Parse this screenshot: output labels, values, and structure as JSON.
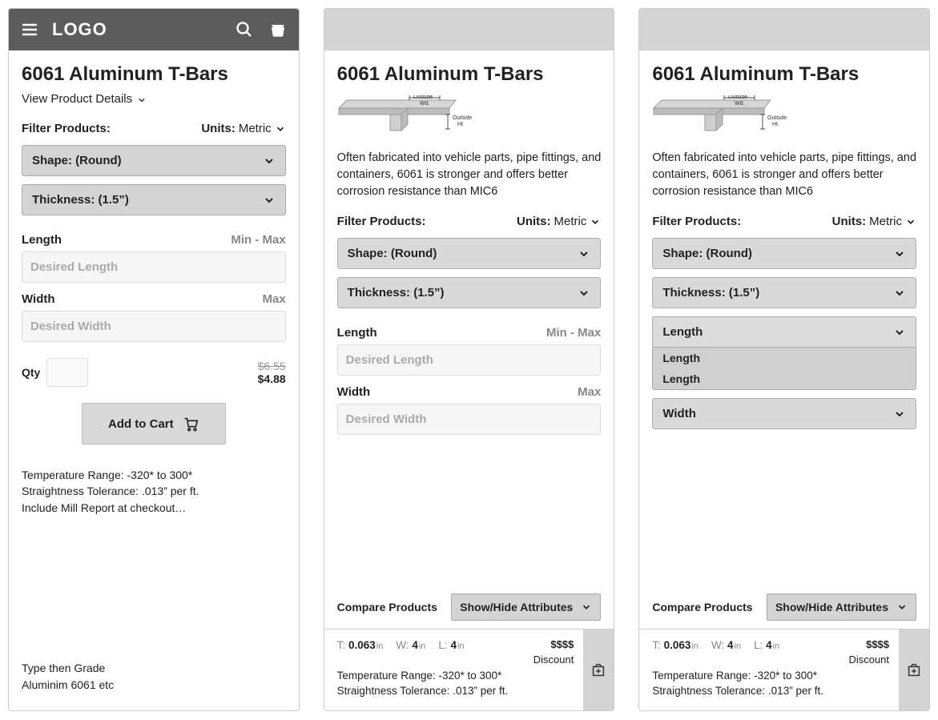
{
  "header": {
    "logo": "LOGO"
  },
  "product": {
    "title": "6061 Aluminum T-Bars",
    "view_details": "View Product Details",
    "image_labels": {
      "outside_wd": "Outside\nWd.",
      "outside_ht": "Outside\nHt."
    },
    "description": "Often fabricated into vehicle parts, pipe fittings, and containers, 6061 is stronger and offers better corrosion resistance than MIC6"
  },
  "filter": {
    "label": "Filter Products:",
    "units_label": "Units:",
    "units_value": "Metric",
    "shape": "Shape: (Round)",
    "thickness": "Thickness: (1.5”)",
    "length_label": "Length",
    "length_hint": "Min - Max",
    "length_placeholder": "Desired Length",
    "width_label": "Width",
    "width_hint": "Max",
    "width_placeholder": "Desired Width",
    "length_dd": {
      "head": "Length",
      "items": [
        "Length",
        "Length"
      ]
    },
    "width_dd": {
      "head": "Width"
    }
  },
  "cart": {
    "qty_label": "Qty",
    "price_old": "$6.55",
    "price_new": "$4.88",
    "add_label": "Add to Cart"
  },
  "specs": {
    "line1": "Temperature Range: -320* to 300*",
    "line2": "Straightness Tolerance: .013” per ft.",
    "line3": "Include Mill Report at checkout…"
  },
  "footer_type": {
    "line1": "Type then Grade",
    "line2": "Aluminim 6061 etc"
  },
  "compare": {
    "label": "Compare Products",
    "toggle": "Show/Hide Attributes"
  },
  "result": {
    "t_lbl": "T:",
    "t_val": "0.063",
    "t_unit": "in",
    "w_lbl": "W:",
    "w_val": "4",
    "w_unit": "in",
    "l_lbl": "L:",
    "l_val": "4",
    "l_unit": "in",
    "price": "$$$$",
    "discount": "Discount",
    "spec1": "Temperature Range: -320* to 300*",
    "spec2": "Straightness Tolerance: .013” per ft."
  }
}
